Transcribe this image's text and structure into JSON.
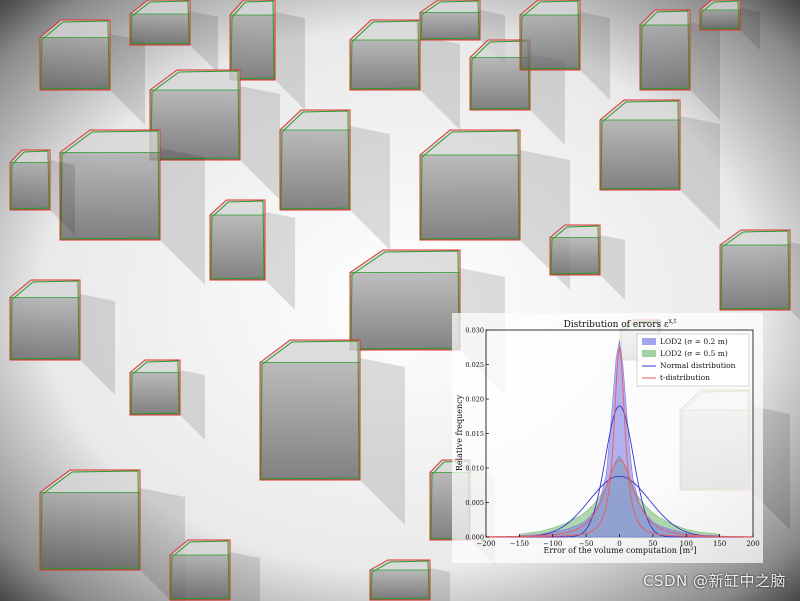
{
  "chart_data": {
    "type": "area",
    "title": "Distribution of errors ε",
    "title_superscript": "x,t",
    "xlabel": "Error of the volume computation [m",
    "xlabel_superscript": "3",
    "xlabel_close": "]",
    "ylabel": "Relative frequency",
    "xlim": [
      -200,
      200
    ],
    "ylim": [
      0,
      0.03
    ],
    "xticks": [
      "−200",
      "−150",
      "−100",
      "−50",
      "0",
      "50",
      "100",
      "150",
      "200"
    ],
    "yticks": [
      "0.000",
      "0.005",
      "0.010",
      "0.015",
      "0.020",
      "0.025",
      "0.030"
    ],
    "legend_position": "top-right",
    "series": [
      {
        "name": "LOD2 (σ = 0.2 m)",
        "kind": "histogram",
        "color": "#7f7fe6",
        "x": [
          -150,
          -120,
          -100,
          -80,
          -60,
          -50,
          -40,
          -30,
          -20,
          -15,
          -10,
          -5,
          0,
          5,
          10,
          15,
          20,
          30,
          40,
          50,
          60,
          80,
          100,
          120,
          150
        ],
        "y": [
          0.0002,
          0.0004,
          0.0007,
          0.0011,
          0.0018,
          0.0024,
          0.0034,
          0.005,
          0.009,
          0.014,
          0.02,
          0.026,
          0.0285,
          0.025,
          0.019,
          0.013,
          0.0085,
          0.0048,
          0.0032,
          0.0022,
          0.0016,
          0.001,
          0.0006,
          0.0003,
          0.0002
        ]
      },
      {
        "name": "LOD2 (σ = 0.5 m)",
        "kind": "histogram",
        "color": "#7fbf7f",
        "x": [
          -150,
          -120,
          -100,
          -80,
          -60,
          -50,
          -40,
          -30,
          -20,
          -15,
          -10,
          -5,
          0,
          5,
          10,
          15,
          20,
          30,
          40,
          50,
          60,
          80,
          100,
          120,
          150
        ],
        "y": [
          0.0004,
          0.0008,
          0.0013,
          0.002,
          0.003,
          0.0037,
          0.0046,
          0.0058,
          0.0072,
          0.0085,
          0.01,
          0.0112,
          0.0118,
          0.011,
          0.0098,
          0.0084,
          0.007,
          0.0056,
          0.0044,
          0.0035,
          0.0028,
          0.0018,
          0.0011,
          0.0007,
          0.0004
        ]
      },
      {
        "name": "Normal distribution",
        "kind": "line",
        "color": "#3333cc"
      },
      {
        "name": "t-distribution",
        "kind": "line",
        "color": "#e65c5c"
      }
    ],
    "curves": {
      "normal_sigma02": {
        "mean": 0,
        "sd": 21,
        "peak": 0.019
      },
      "normal_sigma05": {
        "mean": 0,
        "sd": 45,
        "peak": 0.0088
      },
      "t_sigma02": {
        "mean": 0,
        "scale": 9,
        "df": 1.6,
        "peak": 0.0275
      },
      "t_sigma05": {
        "mean": 0,
        "scale": 24,
        "df": 2.2,
        "peak": 0.0112
      }
    },
    "colors": {
      "panel_bg": "#ffffff",
      "frame": "#000000"
    }
  },
  "watermark": "CSDN @新缸中之脑"
}
